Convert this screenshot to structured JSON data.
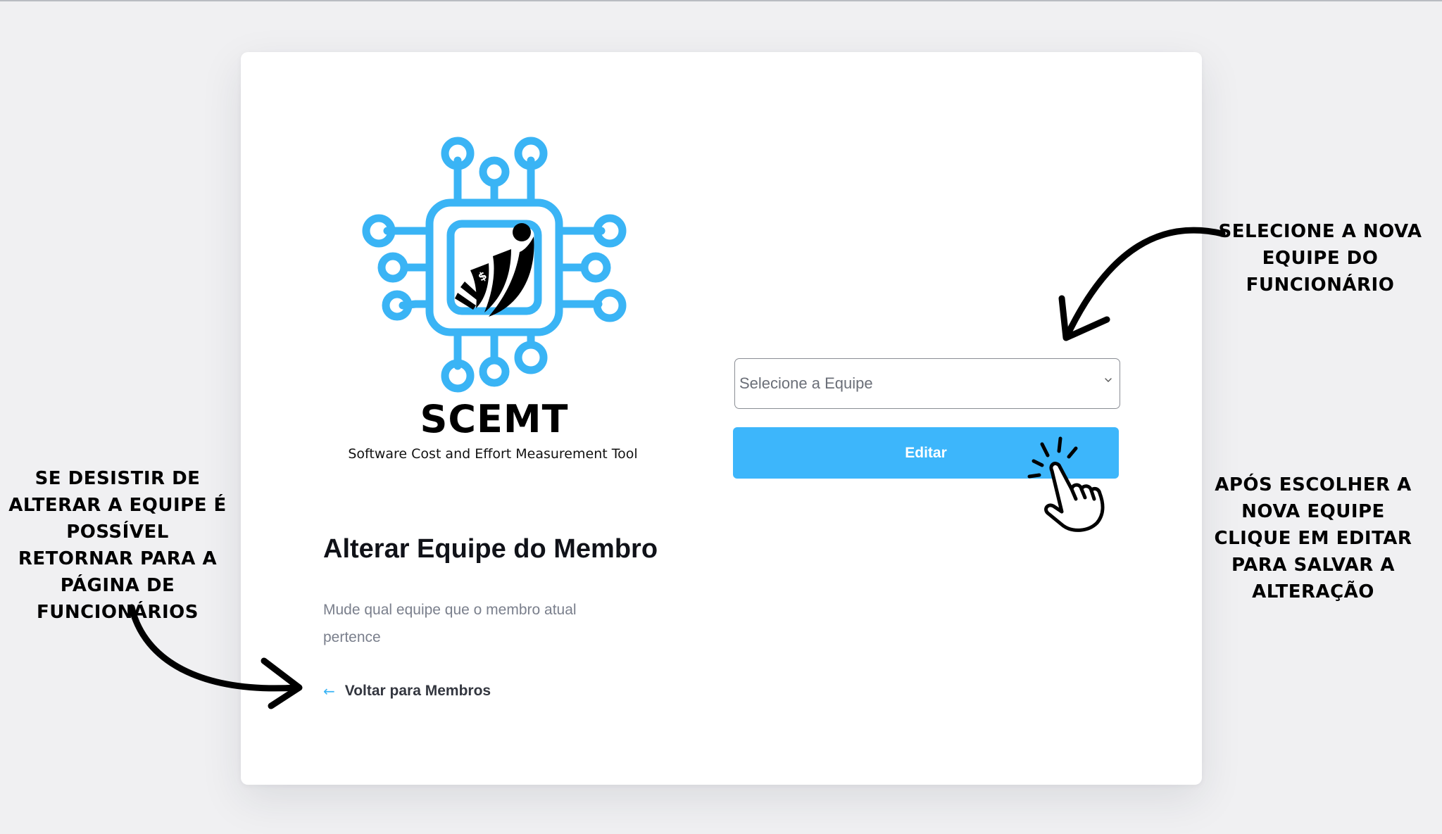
{
  "brand": {
    "name": "SCEMT",
    "tagline": "Software Cost and Effort Measurement Tool",
    "logo_icon": "circuit-chip-logo-icon",
    "accent_color": "#3ab4f5"
  },
  "page": {
    "title": "Alterar Equipe do Membro",
    "description": "Mude qual equipe que o membro atual pertence"
  },
  "back_link": {
    "arrow_icon": "arrow-left-icon",
    "label": "Voltar para Membros"
  },
  "team_select": {
    "placeholder": "Selecione a Equipe",
    "chevron_icon": "chevron-down-icon"
  },
  "edit_button": {
    "label": "Editar",
    "color": "#3db6fb"
  },
  "annotations": {
    "select_hint": "SELECIONE A NOVA EQUIPE DO FUNCIONÁRIO",
    "edit_hint": "APÓS ESCOLHER A NOVA EQUIPE CLIQUE EM EDITAR PARA SALVAR A ALTERAÇÃO",
    "back_hint": "SE DESISTIR DE ALTERAR A EQUIPE É POSSÍVEL RETORNAR PARA A PÁGINA DE FUNCIONÁRIOS"
  }
}
